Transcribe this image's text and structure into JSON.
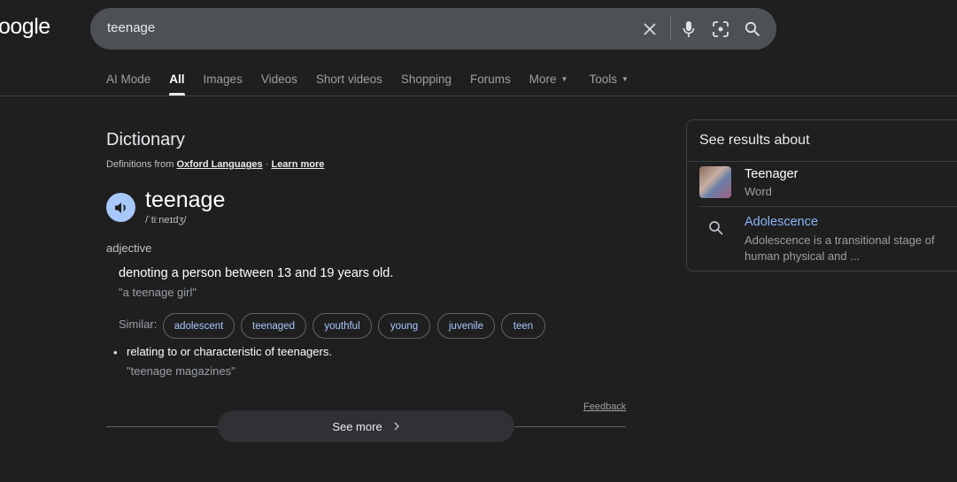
{
  "logo": "oogle",
  "search": {
    "query": "teenage"
  },
  "tabs": [
    {
      "label": "AI Mode"
    },
    {
      "label": "All"
    },
    {
      "label": "Images"
    },
    {
      "label": "Videos"
    },
    {
      "label": "Short videos"
    },
    {
      "label": "Shopping"
    },
    {
      "label": "Forums"
    },
    {
      "label": "More"
    },
    {
      "label": "Tools"
    }
  ],
  "dictionary": {
    "title": "Dictionary",
    "source_prefix": "Definitions from",
    "source_link": "Oxford Languages",
    "separator": "·",
    "learn_more": "Learn more",
    "word": "teenage",
    "phonetic": "/ˈtiːneɪdʒ/",
    "pos": "adjective",
    "def1": "denoting a person between 13 and 19 years old.",
    "ex1": "\"a teenage girl\"",
    "similar_label": "Similar:",
    "similar": [
      "adolescent",
      "teenaged",
      "youthful",
      "young",
      "juvenile",
      "teen"
    ],
    "def2": "relating to or characteristic of teenagers.",
    "ex2": "\"teenage magazines\"",
    "feedback": "Feedback",
    "see_more": "See more"
  },
  "panel": {
    "title": "See results about",
    "items": [
      {
        "name": "Teenager",
        "sub": "Word"
      },
      {
        "name": "Adolescence",
        "sub": "Adolescence is a transitional stage of human physical and ..."
      }
    ]
  }
}
